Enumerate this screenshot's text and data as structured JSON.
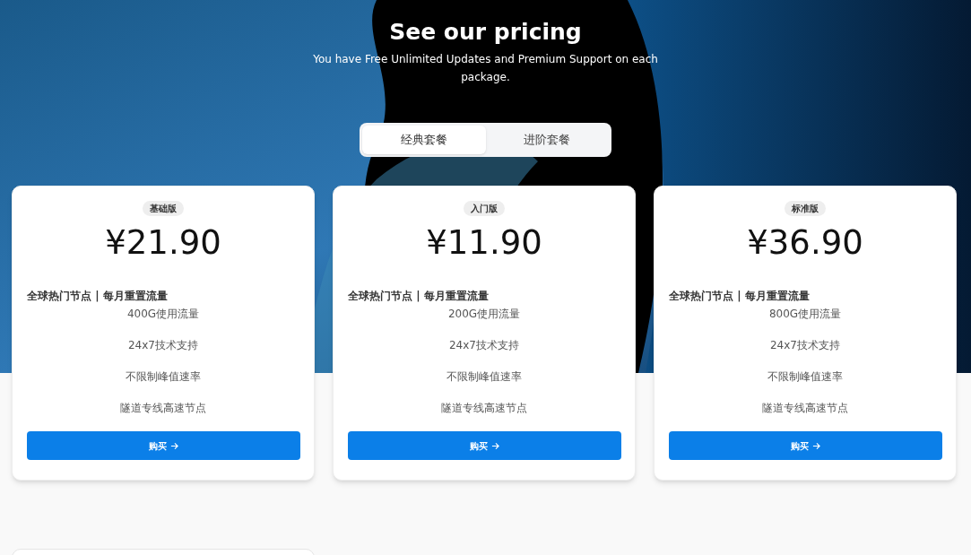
{
  "header": {
    "title": "See our pricing",
    "subtitle": "You have Free Unlimited Updates and Premium Support on each package."
  },
  "tabs": [
    {
      "label": "经典套餐",
      "selected": true
    },
    {
      "label": "进阶套餐",
      "selected": false
    }
  ],
  "plans": [
    {
      "badge": "基础版",
      "price": "¥21.90",
      "heading": "全球热门节点 | 每月重置流量",
      "features": [
        "400G使用流量",
        "24x7技术支持",
        "不限制峰值速率",
        "隧道专线高速节点"
      ],
      "button": "购买"
    },
    {
      "badge": "入门版",
      "price": "¥11.90",
      "heading": "全球热门节点 | 每月重置流量",
      "features": [
        "200G使用流量",
        "24x7技术支持",
        "不限制峰值速率",
        "隧道专线高速节点"
      ],
      "button": "购买"
    },
    {
      "badge": "标准版",
      "price": "¥36.90",
      "heading": "全球热门节点 | 每月重置流量",
      "features": [
        "800G使用流量",
        "24x7技术支持",
        "不限制峰值速率",
        "隧道专线高速节点"
      ],
      "button": "购买"
    }
  ]
}
